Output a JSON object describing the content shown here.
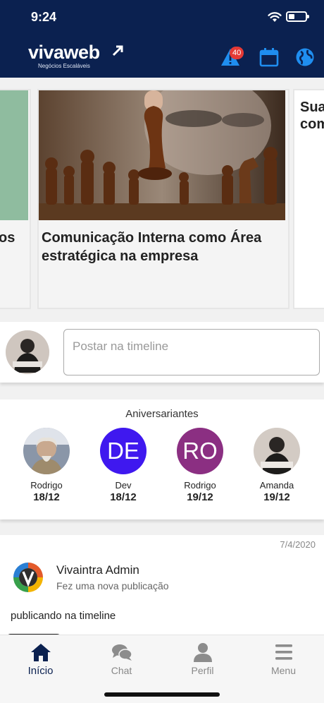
{
  "status": {
    "time": "9:24"
  },
  "header": {
    "logo_text": "vivaweb",
    "logo_sub": "Negócios Escaláveis",
    "notifications_count": "40",
    "icons": [
      "alert-icon",
      "calendar-icon",
      "globe-icon"
    ],
    "bg_color": "#0b2150"
  },
  "carousel": {
    "left_partial_text": "os",
    "main_title": "Comunicação Interna como Área estratégica na empresa",
    "right_partial_text": "Sua\ncom"
  },
  "post": {
    "placeholder": "Postar na timeline"
  },
  "birthdays": {
    "title": "Aniversariantes",
    "people": [
      {
        "name": "Rodrigo",
        "date": "18/12",
        "initials": "",
        "color": ""
      },
      {
        "name": "Dev",
        "date": "18/12",
        "initials": "DE",
        "color": "#3f18ef"
      },
      {
        "name": "Rodrigo",
        "date": "19/12",
        "initials": "RO",
        "color": "#8b2f82"
      },
      {
        "name": "Amanda",
        "date": "19/12",
        "initials": "",
        "color": ""
      }
    ]
  },
  "feed": {
    "date": "7/4/2020",
    "author": "Vivaintra Admin",
    "action": "Fez uma nova publicação",
    "text": "publicando na timeline"
  },
  "tabs": [
    {
      "label": "Início",
      "icon": "home-icon",
      "active": true
    },
    {
      "label": "Chat",
      "icon": "chat-icon",
      "active": false
    },
    {
      "label": "Perfil",
      "icon": "user-icon",
      "active": false
    },
    {
      "label": "Menu",
      "icon": "menu-icon",
      "active": false
    }
  ]
}
